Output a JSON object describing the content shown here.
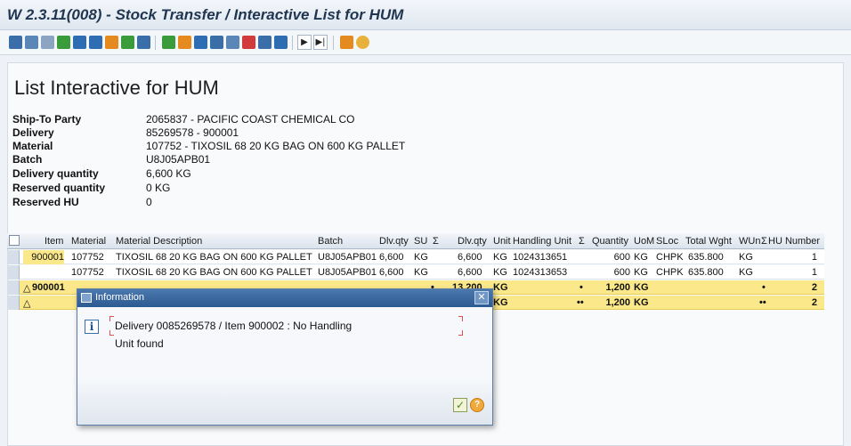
{
  "window": {
    "title": "W 2.3.11(008) - Stock Transfer / Interactive List for HUM"
  },
  "toolbar": {
    "icons": [
      "search-icon",
      "detail-icon",
      "layout-icon",
      "sort-asc-icon",
      "filter-icon",
      "filter-set-icon",
      "grid-icon",
      "view-icon",
      "export-icon",
      "spreadsheet-icon",
      "local-file-icon",
      "mail-icon",
      "print-icon",
      "abc-icon",
      "graphic-icon",
      "select-icon",
      "layout-change-icon",
      "next-icon",
      "last-icon",
      "tools-icon",
      "refresh-icon"
    ],
    "colors": {
      "green": "#3a9b3a",
      "blue": "#2f6db3",
      "orange": "#e58a1f",
      "red": "#d23b3b"
    }
  },
  "page": {
    "title": "List Interactive for HUM",
    "fields": [
      {
        "label": "Ship-To Party",
        "value": "2065837 - PACIFIC COAST CHEMICAL CO"
      },
      {
        "label": "Delivery",
        "value": "85269578 - 900001"
      },
      {
        "label": "Material",
        "value": "107752 - TIXOSIL 68 20 KG BAG ON 600 KG PALLET"
      },
      {
        "label": "Batch",
        "value": "U8J05APB01"
      },
      {
        "label": "Delivery quantity",
        "value": "6,600 KG"
      },
      {
        "label": "Reserved quantity",
        "value": "0 KG"
      },
      {
        "label": "Reserved HU",
        "value": "0"
      }
    ]
  },
  "grid": {
    "columns": [
      "Item",
      "Material",
      "Material Description",
      "Batch",
      "Dlv.qty",
      "SU",
      "Σ",
      "Dlv.qty",
      "Unit",
      "Handling Unit",
      "Σ",
      "Quantity",
      "UoM",
      "SLoc",
      "Total Wght",
      "WUn",
      "Σ",
      "HU Number"
    ],
    "rows": [
      {
        "item": "900001",
        "material": "107752",
        "desc": "TIXOSIL 68 20 KG BAG ON 600 KG PALLET",
        "batch": "U8J05APB01",
        "dlvqty": "6,600",
        "su": "KG",
        "dlvqty2": "6,600",
        "unit": "KG",
        "hu": "1024313651",
        "qty": "600",
        "uom": "KG",
        "sloc": "CHPK",
        "twght": "635.800",
        "wun": "KG",
        "hunum": "1"
      },
      {
        "item": "",
        "material": "107752",
        "desc": "TIXOSIL 68 20 KG BAG ON 600 KG PALLET",
        "batch": "U8J05APB01",
        "dlvqty": "6,600",
        "su": "KG",
        "dlvqty2": "6,600",
        "unit": "KG",
        "hu": "1024313653",
        "qty": "600",
        "uom": "KG",
        "sloc": "CHPK",
        "twght": "635.800",
        "wun": "KG",
        "hunum": "1"
      }
    ],
    "subtotal": {
      "item": "900001",
      "dot1": "•",
      "dlvqty2": "13,200",
      "unit": "KG",
      "dot2": "•",
      "qty": "1,200",
      "uom": "KG",
      "dot3": "•",
      "hunum": "2"
    },
    "total": {
      "dot1": "••",
      "unit": "KG",
      "dot2": "••",
      "qty": "1,200",
      "uom": "KG",
      "dot3": "••",
      "hunum": "2"
    }
  },
  "dialog": {
    "title": "Information",
    "message_line1": "Delivery 0085269578 / Item 900002 : No Handling",
    "message_line2": "Unit found"
  }
}
